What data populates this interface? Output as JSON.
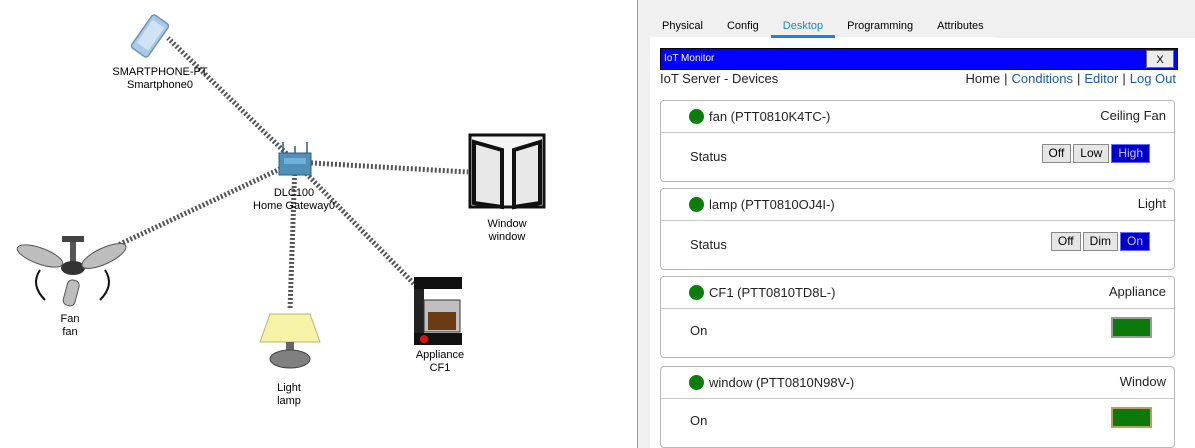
{
  "canvas": {
    "labels": {
      "smartphone_l1": "SMARTPHONE-PT",
      "smartphone_l2": "Smartphone0",
      "gateway_l1": "DLC100",
      "gateway_l2": "Home Gateway0",
      "window_l1": "Window",
      "window_l2": "window",
      "fan_l1": "Fan",
      "fan_l2": "fan",
      "light_l1": "Light",
      "light_l2": "lamp",
      "appliance_l1": "Appliance",
      "appliance_l2": "CF1"
    }
  },
  "tabs": [
    "Physical",
    "Config",
    "Desktop",
    "Programming",
    "Attributes"
  ],
  "active_tab": "Desktop",
  "monitor": {
    "title": "IoT Monitor",
    "close": "X",
    "server_title": "IoT Server - Devices",
    "nav": {
      "home": "Home",
      "conditions": "Conditions",
      "editor": "Editor",
      "logout": "Log Out",
      "sep": "|"
    }
  },
  "devices": [
    {
      "name": "fan (PTT0810K4TC-)",
      "type": "Ceiling Fan",
      "row_label": "Status",
      "options": [
        "Off",
        "Low",
        "High"
      ],
      "selected": "High"
    },
    {
      "name": "lamp (PTT0810OJ4I-)",
      "type": "Light",
      "row_label": "Status",
      "options": [
        "Off",
        "Dim",
        "On"
      ],
      "selected": "On"
    },
    {
      "name": "CF1 (PTT0810TD8L-)",
      "type": "Appliance",
      "row_label": "On"
    },
    {
      "name": "window (PTT0810N98V-)",
      "type": "Window",
      "row_label": "On"
    }
  ],
  "colors": {
    "status_online": "#0a7d0a",
    "title_bar": "#0000ff",
    "selected_button": "#0000cc",
    "accent_tab": "#1a88c9"
  }
}
